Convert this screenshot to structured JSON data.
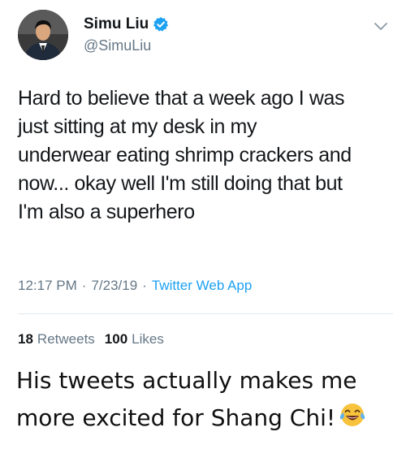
{
  "tweet": {
    "display_name": "Simu Liu",
    "verified_icon": "verified-badge-icon",
    "handle": "@SimuLiu",
    "menu_icon": "chevron-down-icon",
    "text": "Hard to believe that a week ago I was\njust sitting at my desk in my\nunderwear eating shrimp crackers and\nnow... okay well I'm still doing that but\nI'm also a superhero",
    "time": "12:17 PM",
    "separator": "·",
    "date": "7/23/19",
    "source": "Twitter Web App",
    "retweets_count": "18",
    "retweets_label": "Retweets",
    "likes_count": "100",
    "likes_label": "Likes"
  },
  "caption": {
    "text": "His tweets actually makes me more excited for Shang Chi!",
    "emoji_icon": "face-with-tears-of-joy-icon"
  },
  "colors": {
    "accent": "#1da1f2",
    "secondary_text": "#657786",
    "primary_text": "#14171a",
    "divider": "#e1e8ed"
  }
}
